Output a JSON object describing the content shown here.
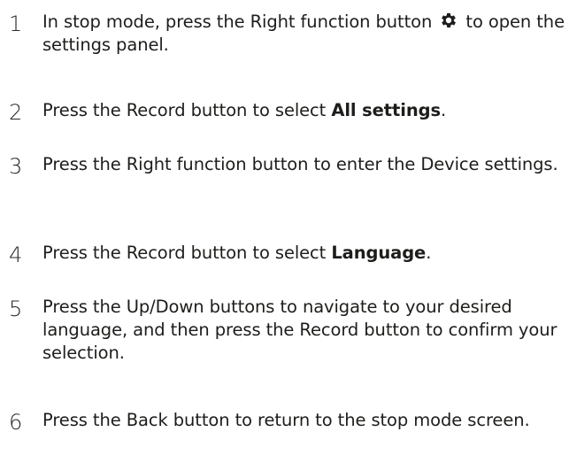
{
  "steps": [
    {
      "number": "1",
      "before": "In stop mode, press the Right function button ",
      "icon": "gear-icon",
      "after": " to open the settings panel."
    },
    {
      "number": "2",
      "before": "Press the Record button to select ",
      "bold": "All settings",
      "after": "."
    },
    {
      "number": "3",
      "text": "Press the Right function button to enter the Device settings."
    },
    {
      "number": "4",
      "before": " Press the Record button to select ",
      "bold": "Language",
      "after": "."
    },
    {
      "number": "5",
      "text": "Press the Up/Down buttons to navigate to your desired language, and then press the Record button to confirm your selection."
    },
    {
      "number": "6",
      "text": "Press the Back button to return to the stop mode screen."
    }
  ]
}
